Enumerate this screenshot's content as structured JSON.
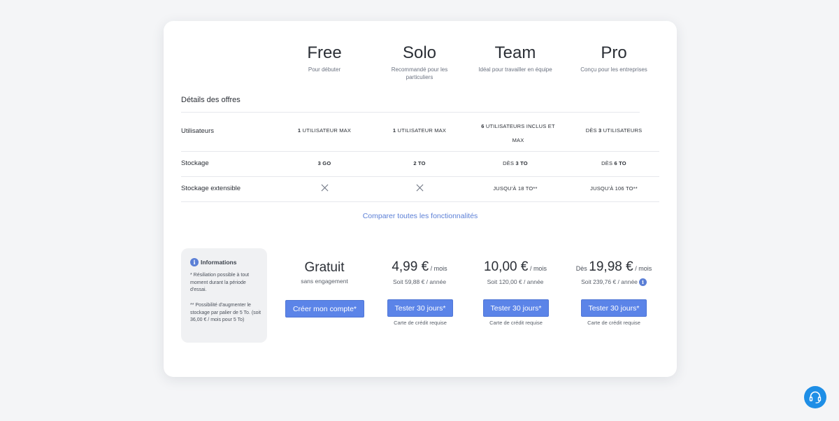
{
  "plans": [
    {
      "name": "Free",
      "subtitle": "Pour débuter"
    },
    {
      "name": "Solo",
      "subtitle": "Recommandé pour les particuliers"
    },
    {
      "name": "Team",
      "subtitle": "Idéal pour travailler en équipe"
    },
    {
      "name": "Pro",
      "subtitle": "Conçu pour les entreprises"
    }
  ],
  "details": {
    "title": "Détails des offres",
    "rows": [
      {
        "label": "Utilisateurs",
        "cells": [
          {
            "strong": "1",
            "text": " UTILISATEUR MAX"
          },
          {
            "strong": "1",
            "text": " UTILISATEUR MAX"
          },
          {
            "strong": "6",
            "text": " UTILISATEURS INCLUS ET MAX"
          },
          {
            "pre": "DÈS ",
            "strong": "3",
            "text": " UTILISATEURS"
          }
        ]
      },
      {
        "label": "Stockage",
        "cells": [
          {
            "strong": "3 GO"
          },
          {
            "strong": "2 TO"
          },
          {
            "pre": "DÈS ",
            "strong": "3 TO"
          },
          {
            "pre": "DÈS ",
            "strong": "6 TO"
          }
        ]
      },
      {
        "label": "Stockage extensible",
        "cells": [
          {
            "icon": "x-icon"
          },
          {
            "icon": "x-icon"
          },
          {
            "text": "JUSQU'À 18 TO**"
          },
          {
            "text": "JUSQU'À 106 TO**"
          }
        ]
      }
    ]
  },
  "compare_link": "Comparer toutes les fonctionnalités",
  "info": {
    "title": "Informations",
    "note1": "* Résiliation possible à tout moment durant la période d'essai.",
    "note2": "** Possibilité d'augmenter le stockage par palier de 5 To. (soit 36,00 € / mois pour 5 To)"
  },
  "pricing": {
    "free": {
      "price": "Gratuit",
      "sub": "sans engagement",
      "button": "Créer mon compte*"
    },
    "solo": {
      "price": "4,99 €",
      "per": " / mois",
      "sub": "Soit 59,88 € / année",
      "button": "Tester 30 jours*",
      "note": "Carte de crédit requise"
    },
    "team": {
      "price": "10,00 €",
      "per": " / mois",
      "sub": "Soit 120,00 € / année",
      "button": "Tester 30 jours*",
      "note": "Carte de crédit requise"
    },
    "pro": {
      "prefix": "Dès ",
      "price": "19,98 €",
      "per": " / mois",
      "sub": "Soit 239,76 € / année",
      "button": "Tester 30 jours*",
      "note": "Carte de crédit requise"
    }
  },
  "colors": {
    "accent": "#5b84e8",
    "link": "#5b7fd6",
    "support": "#1e8ee6"
  },
  "icons": {
    "info": "info-icon",
    "support": "headset-icon",
    "unavailable": "x-icon"
  }
}
